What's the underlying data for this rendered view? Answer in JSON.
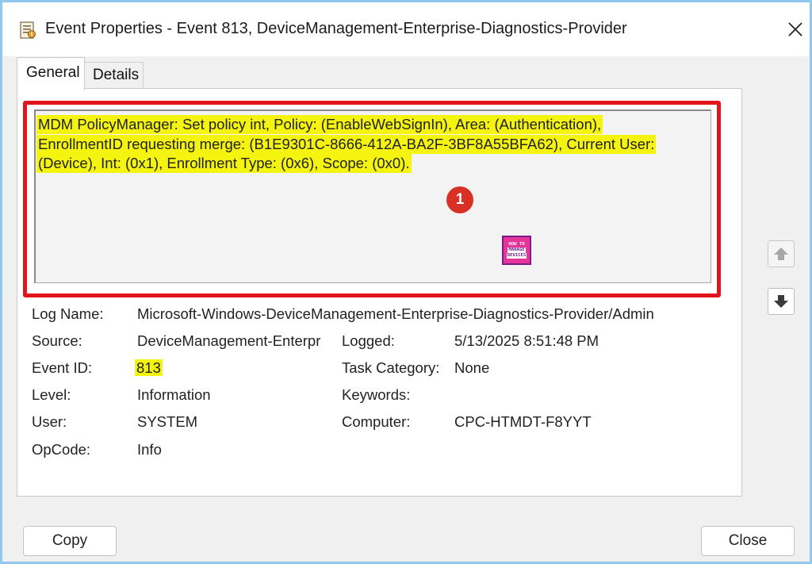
{
  "window": {
    "title": "Event Properties - Event 813, DeviceManagement-Enterprise-Diagnostics-Provider"
  },
  "tabs": [
    {
      "label": "General",
      "selected": true
    },
    {
      "label": "Details",
      "selected": false
    }
  ],
  "general": {
    "message_lines": [
      "MDM PolicyManager: Set policy int, Policy: (EnableWebSignIn), Area: (Authentication),",
      "EnrollmentID requesting merge: (B1E9301C-8666-412A-BA2F-3BF8A55BFA62), Current User:",
      "(Device), Int: (0x1), Enrollment Type: (0x6), Scope: (0x0)."
    ],
    "callout_number": "1",
    "fields": {
      "log_name": {
        "label": "Log Name:",
        "value": "Microsoft-Windows-DeviceManagement-Enterprise-Diagnostics-Provider/Admin"
      },
      "source": {
        "label": "Source:",
        "value": "DeviceManagement-Enterpr"
      },
      "logged": {
        "label": "Logged:",
        "value": "5/13/2025 8:51:48 PM"
      },
      "event_id": {
        "label": "Event ID:",
        "value": "813"
      },
      "task_category": {
        "label": "Task Category:",
        "value": "None"
      },
      "level": {
        "label": "Level:",
        "value": "Information"
      },
      "keywords": {
        "label": "Keywords:",
        "value": ""
      },
      "user": {
        "label": "User:",
        "value": "SYSTEM"
      },
      "computer": {
        "label": "Computer:",
        "value": "CPC-HTMDT-F8YYT"
      },
      "opcode": {
        "label": "OpCode:",
        "value": "Info"
      }
    }
  },
  "watermark": {
    "lines": [
      "HOW TO",
      "MANAGE",
      "DEVICES"
    ]
  },
  "buttons": {
    "copy": "Copy",
    "close": "Close"
  },
  "icons": {
    "app": "event-viewer-icon",
    "close": "close-icon",
    "scroll_up": "arrow-up-icon",
    "scroll_down": "arrow-down-icon"
  },
  "colors": {
    "highlight": "#f4f410",
    "callout_border": "#e3151c",
    "callout_badge": "#d93025",
    "window_border": "#8ec8ee"
  }
}
